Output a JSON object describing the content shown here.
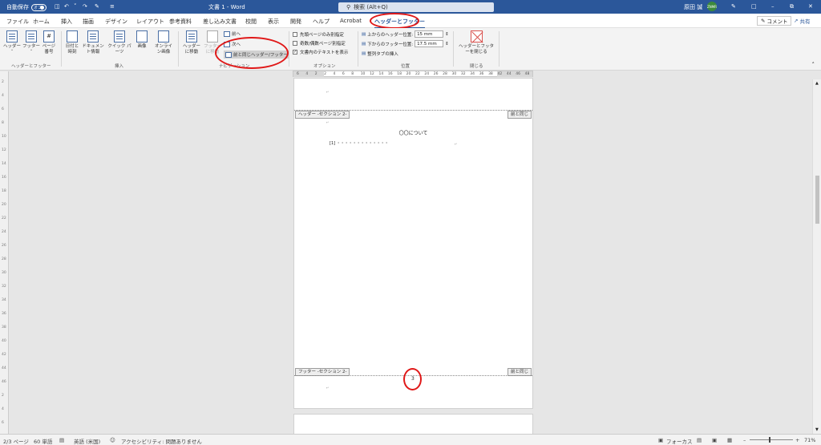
{
  "title": {
    "autosave_label": "自動保存",
    "autosave_state": "オフ",
    "doc_title": "文書 1 - Word",
    "search_placeholder": "検索 (Alt+Q)",
    "user_name": "原田 誠",
    "avatar_text": "ZNMR"
  },
  "tabs": [
    "ファイル",
    "ホーム",
    "挿入",
    "描画",
    "デザイン",
    "レイアウト",
    "参考資料",
    "差し込み文書",
    "校閲",
    "表示",
    "開発",
    "ヘルプ",
    "Acrobat",
    "ヘッダーとフッター"
  ],
  "active_tab_index": 13,
  "top_right": {
    "comments": "コメント",
    "share": "共有"
  },
  "ribbon": {
    "hf_group": {
      "header": "ヘッダー",
      "footer": "フッター",
      "page_number": "ページ番号",
      "label": "ヘッダーとフッター"
    },
    "insert_group": {
      "datetime": "日付と時刻",
      "docinfo": "ドキュメント情報",
      "quickparts": "クイック パーツ",
      "picture": "画像",
      "online_picture": "オンライン画像",
      "label": "挿入"
    },
    "nav_group": {
      "goto_header": "ヘッダーに移動",
      "goto_footer": "フッターに移動",
      "prev": "前へ",
      "next": "次へ",
      "link_prev": "前と同じヘッダー/フッター",
      "label": "ナビゲーション"
    },
    "options_group": {
      "first_page": "先頭ページのみ別指定",
      "odd_even": "奇数/偶数ページ別指定",
      "show_text": "文書内のテキストを表示",
      "show_text_checked": true,
      "label": "オプション"
    },
    "position_group": {
      "header_top_label": "上からのヘッダー位置:",
      "header_top_value": "15 mm",
      "footer_bottom_label": "下からのフッター位置:",
      "footer_bottom_value": "17.5 mm",
      "align_tab": "整列タブの挿入",
      "label": "位置"
    },
    "close_group": {
      "close_button": "ヘッダーとフッターを閉じる",
      "label": "閉じる"
    }
  },
  "hruler_labels": [
    "6",
    "4",
    "2",
    "2",
    "4",
    "6",
    "8",
    "10",
    "12",
    "14",
    "16",
    "18",
    "20",
    "22",
    "24",
    "26",
    "28",
    "30",
    "32",
    "34",
    "36",
    "38",
    "42",
    "44",
    "46",
    "48"
  ],
  "vruler_labels": [
    "2",
    "4",
    "6",
    "8",
    "10",
    "12",
    "14",
    "16",
    "18",
    "20",
    "22",
    "24",
    "26",
    "28",
    "30",
    "32",
    "34",
    "36",
    "38",
    "40",
    "42",
    "44",
    "46",
    "2",
    "4",
    "6"
  ],
  "page": {
    "header_tag": "ヘッダー -セクション 2-",
    "same_as_prev": "前と同じ",
    "heading": "〇〇について",
    "body_line": "[1] ・・・・・・・・・・・・・",
    "footer_tag": "フッター -セクション 2-",
    "footer_number": "3"
  },
  "status": {
    "page": "2/3 ページ",
    "words": "60 単語",
    "language": "英語 (米国)",
    "accessibility": "アクセシビリティ: 問題ありません",
    "focus": "フォーカス",
    "zoom": "71%"
  }
}
